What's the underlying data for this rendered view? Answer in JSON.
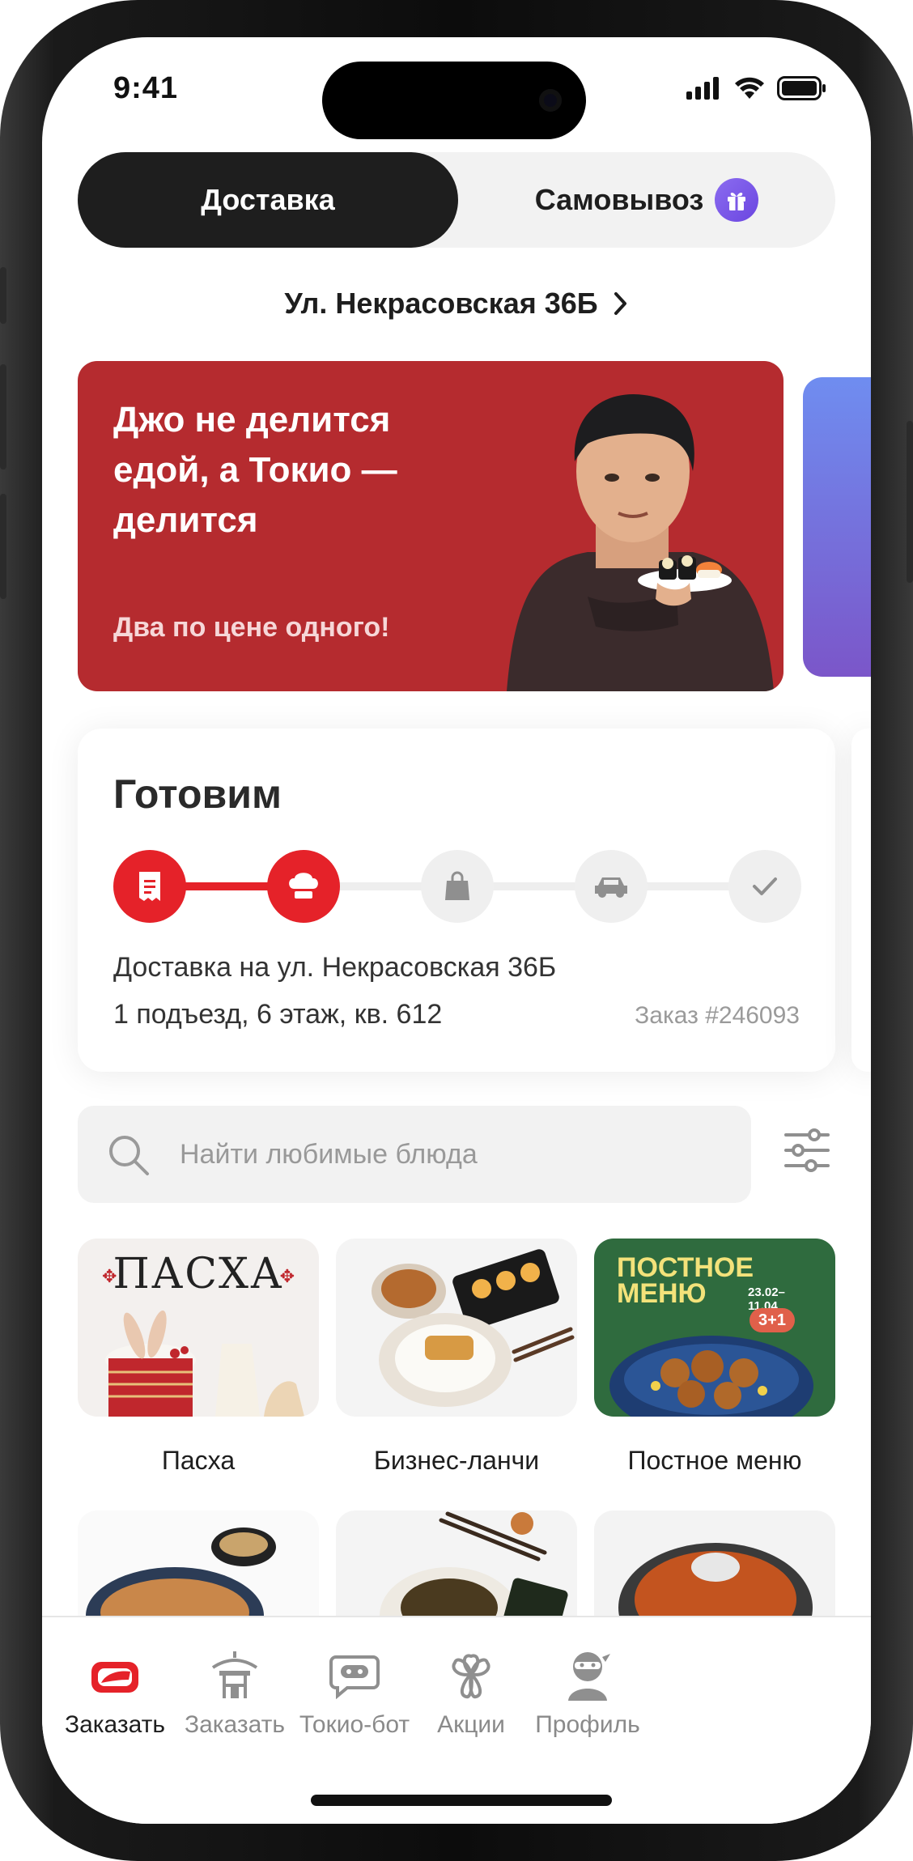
{
  "status_bar": {
    "time": "9:41"
  },
  "delivery_toggle": {
    "active": "Доставка",
    "other": "Самовывоз"
  },
  "address": "Ул. Некрасовская 36Б",
  "promo_banner": {
    "title": "Джо не делится едой, а Токио — делится",
    "subtitle": "Два по цене одного!"
  },
  "order_status": {
    "title": "Готовим",
    "steps": [
      "receipt-icon",
      "chef-hat-icon",
      "bag-icon",
      "car-icon",
      "check-icon"
    ],
    "progress_step": 2,
    "address_line": "Доставка на ул. Некрасовская 36Б",
    "details_line": "1 подъезд, 6 этаж, кв. 612",
    "order_number": "Заказ #246093"
  },
  "search": {
    "placeholder": "Найти любимые блюда"
  },
  "categories": [
    {
      "label": "Пасха",
      "image_text": "ПАСХА"
    },
    {
      "label": "Бизнес-ланчи"
    },
    {
      "label": "Постное меню",
      "image_text": "ПОСТНОЕ МЕНЮ",
      "image_dates": "23.02–11.04",
      "image_badge": "3+1"
    }
  ],
  "tabbar": [
    {
      "label": "Заказать",
      "icon": "sushi-icon",
      "active": true
    },
    {
      "label": "Заказать",
      "icon": "pagoda-icon",
      "active": false
    },
    {
      "label": "Токио-бот",
      "icon": "bot-icon",
      "active": false
    },
    {
      "label": "Акции",
      "icon": "sakura-icon",
      "active": false
    },
    {
      "label": "Профиль",
      "icon": "ninja-icon",
      "active": false
    }
  ],
  "colors": {
    "accent": "#e52229",
    "banner": "#b52b2f",
    "dark": "#1e1e1e"
  }
}
